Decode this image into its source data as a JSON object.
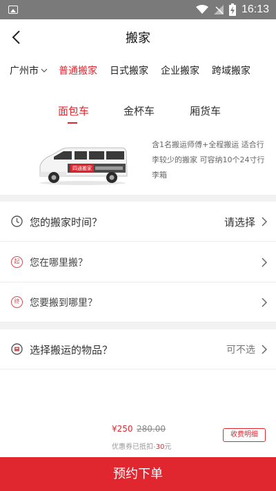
{
  "status_bar": {
    "time": "16:13"
  },
  "header": {
    "title": "搬家"
  },
  "city": {
    "label": "广州市"
  },
  "services": [
    {
      "label": "普通搬家",
      "active": true
    },
    {
      "label": "日式搬家",
      "active": false
    },
    {
      "label": "企业搬家",
      "active": false
    },
    {
      "label": "跨域搬家",
      "active": false
    }
  ],
  "vehicle_tabs": [
    {
      "label": "面包车",
      "active": true
    },
    {
      "label": "金杯车",
      "active": false
    },
    {
      "label": "厢货车",
      "active": false
    }
  ],
  "vehicle": {
    "brand_text": "四通搬家",
    "description_lines": [
      "含1名搬运师傅+全程搬运 适合行",
      "李较少的搬家 可容纳10个24寸行",
      "李箱"
    ]
  },
  "rows": {
    "time": {
      "label": "您的搬家时间？",
      "value": "请选择"
    },
    "from": {
      "icon_text": "起",
      "label": "您在哪里搬？"
    },
    "to": {
      "icon_text": "终",
      "label": "您要搬到哪里？"
    },
    "items": {
      "label": "选择搬运的物品？",
      "value": "可不选"
    }
  },
  "price": {
    "current": "¥250",
    "original": "280.00",
    "coupon_prefix": "优惠券已抵扣-",
    "coupon_amount": "30",
    "coupon_suffix": "元",
    "fee_detail_label": "收费明细"
  },
  "order_button": {
    "label": "预约下单"
  },
  "colors": {
    "accent": "#e0262f",
    "status_bar": "#7a7a7a",
    "separator": "#f2f2f2"
  }
}
